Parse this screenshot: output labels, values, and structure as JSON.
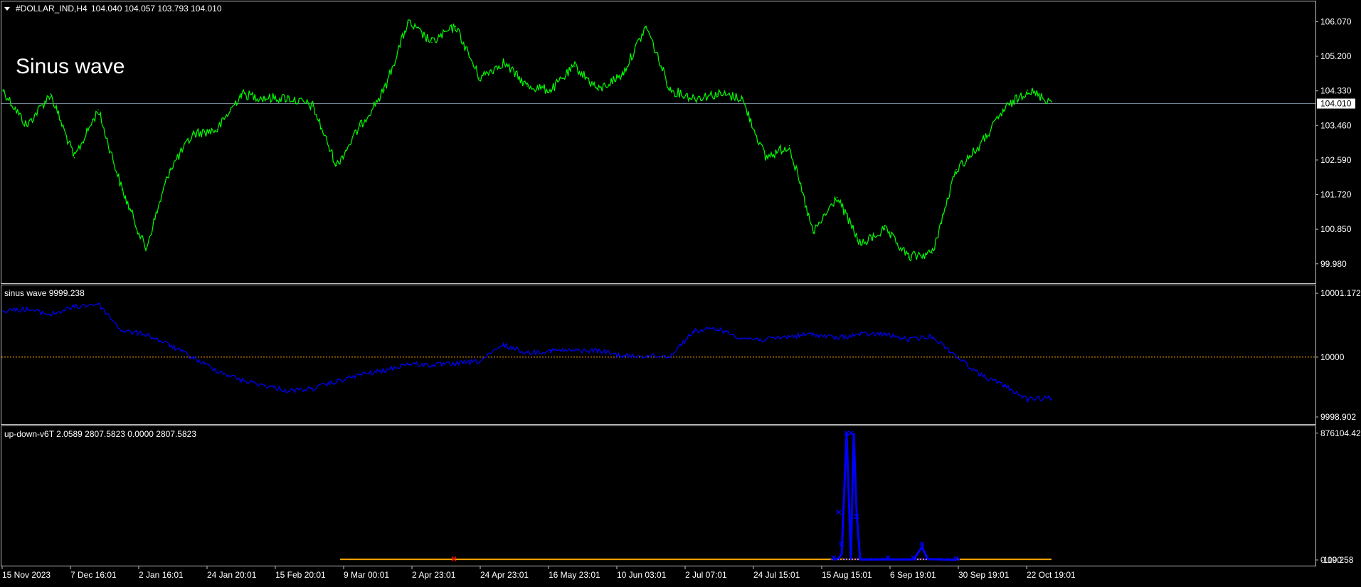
{
  "window": {
    "title": "#DOLLAR_IND,H4",
    "ohlc": "104.040 104.057 103.793 104.010"
  },
  "overlay_label": "Sinus wave",
  "colors": {
    "background": "#000000",
    "border": "#c0c0c0",
    "text": "#ffffff",
    "price_line": "#00ff00",
    "indicator_line": "#0000ff",
    "markers": "#0000ff",
    "red_marker": "#ff0000",
    "base_line": "#ffa500",
    "level_line": "#ffa500",
    "last_price_line": "#708090"
  },
  "chart_data": [
    {
      "id": "price",
      "type": "line",
      "title": "#DOLLAR_IND,H4",
      "series": [
        {
          "values": [
            104.35,
            103.45,
            104.25,
            102.65,
            103.85,
            101.85,
            100.35,
            102.35,
            103.25,
            103.35,
            104.25,
            104.15,
            104.15,
            103.95,
            102.45,
            103.45,
            104.35,
            106.05,
            105.55,
            105.95,
            104.65,
            105.05,
            104.45,
            104.35,
            104.95,
            104.35,
            104.75,
            105.95,
            104.35,
            104.15,
            104.25,
            104.15,
            102.65,
            102.95,
            100.75,
            101.65,
            100.45,
            100.85,
            100.15,
            100.25,
            102.35,
            102.95,
            103.85,
            104.35,
            104.05
          ]
        }
      ],
      "ylim": [
        99.6,
        106.4
      ],
      "y_ticks": [
        "106.070",
        "105.200",
        "104.330",
        "103.460",
        "102.590",
        "101.720",
        "100.850",
        "99.980"
      ],
      "last_price": "104.010",
      "last_price_value": 104.01
    },
    {
      "id": "sinus",
      "type": "line",
      "title": "sinus wave 9999.238",
      "series": [
        {
          "values": [
            10000.85,
            10000.88,
            10000.78,
            10000.92,
            10000.98,
            10000.48,
            10000.42,
            10000.22,
            9999.98,
            9999.75,
            9999.58,
            9999.48,
            9999.38,
            9999.42,
            9999.55,
            9999.68,
            9999.75,
            9999.88,
            9999.85,
            9999.88,
            9999.92,
            10000.22,
            10000.08,
            10000.12,
            10000.12,
            10000.12,
            10000.02,
            10000.02,
            10000.02,
            10000.48,
            10000.52,
            10000.35,
            10000.32,
            10000.38,
            10000.42,
            10000.35,
            10000.42,
            10000.42,
            10000.32,
            10000.38,
            10000.02,
            9999.68,
            9999.48,
            9999.22,
            9999.25
          ]
        }
      ],
      "ylim": [
        9998.85,
        10001.2
      ],
      "y_ticks": [
        "10001.172",
        "10000",
        "9998.902"
      ],
      "level": 10000
    },
    {
      "id": "updown",
      "type": "line",
      "title": "up-down-v6T 2.0589 2807.5823 0.0000 2807.5823",
      "series": [
        {
          "points": [
            [
              1172,
              0
            ],
            [
              1179,
              12000
            ],
            [
              1183,
              40000
            ],
            [
              1190,
              876104.42
            ],
            [
              1196,
              12000
            ],
            [
              1200,
              876104.42
            ],
            [
              1204,
              330000
            ],
            [
              1209,
              3000
            ],
            [
              1248,
              4000
            ],
            [
              1284,
              4000
            ],
            [
              1296,
              90000
            ],
            [
              1304,
              6000
            ],
            [
              1326,
              3000
            ],
            [
              1344,
              2000
            ]
          ]
        }
      ],
      "markers": [
        [
          1172,
          15000
        ],
        [
          1179,
          330000
        ],
        [
          1183,
          110000
        ],
        [
          1190,
          876104.42
        ],
        [
          1196,
          876104.42
        ],
        [
          1204,
          300000
        ],
        [
          1248,
          15000
        ],
        [
          1284,
          15000
        ],
        [
          1296,
          110000
        ],
        [
          1344,
          10000
        ]
      ],
      "red_markers": [
        [
          638,
          8000
        ]
      ],
      "base_line": {
        "value": 4000,
        "x_start": 478,
        "x_end": 1478
      },
      "ylim": [
        -5000,
        880000
      ],
      "y_ticks": [
        "876104.42",
        "-119.258"
      ],
      "y_tick_overlap": "0.000"
    }
  ],
  "x_axis_labels": [
    "15 Nov 2023",
    "7 Dec 16:01",
    "2 Jan 16:01",
    "24 Jan 20:01",
    "15 Feb 20:01",
    "9 Mar 00:01",
    "2 Apr 23:01",
    "24 Apr 23:01",
    "16 May 23:01",
    "10 Jun 03:01",
    "2 Jul 07:01",
    "24 Jul 15:01",
    "15 Aug 15:01",
    "6 Sep 19:01",
    "30 Sep 19:01",
    "22 Oct 19:01"
  ]
}
